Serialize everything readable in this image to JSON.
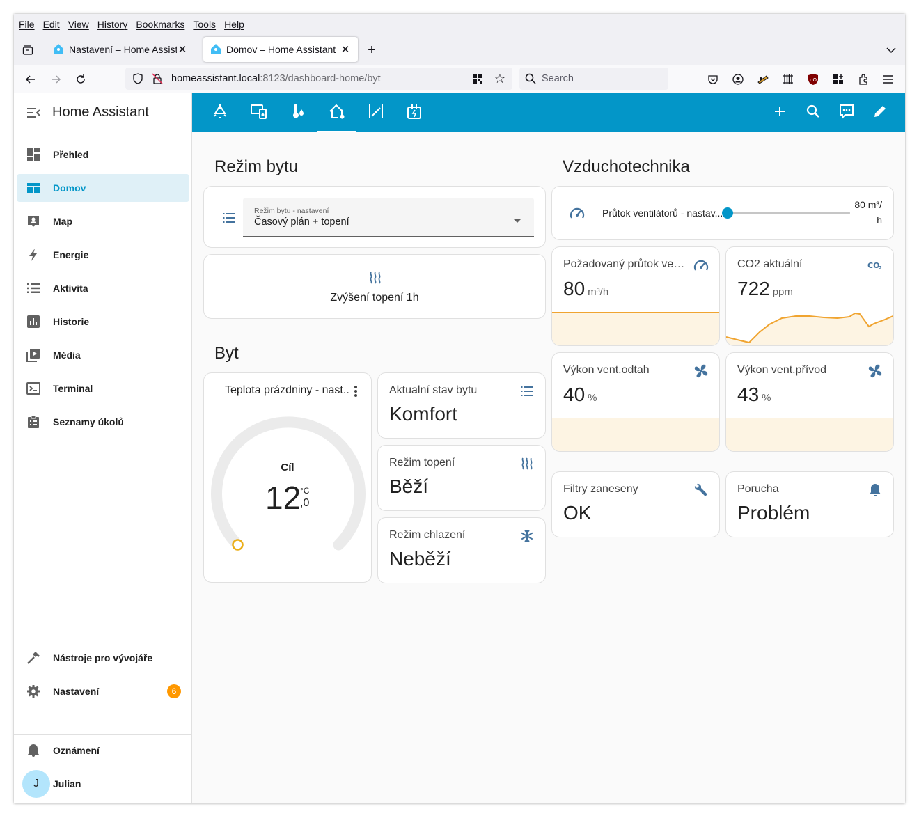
{
  "browser": {
    "menu": [
      "File",
      "Edit",
      "View",
      "History",
      "Bookmarks",
      "Tools",
      "Help"
    ],
    "tabs": [
      {
        "title": "Nastavení – Home Assistant"
      },
      {
        "title": "Domov – Home Assistant"
      }
    ],
    "url_host": "homeassistant.local",
    "url_path": ":8123/dashboard-home/byt",
    "search_placeholder": "Search"
  },
  "sidebar": {
    "title": "Home Assistant",
    "items": [
      {
        "label": "Přehled",
        "icon": "dashboard-icon"
      },
      {
        "label": "Domov",
        "icon": "view-dashboard-icon",
        "selected": true
      },
      {
        "label": "Map",
        "icon": "map-account-icon"
      },
      {
        "label": "Energie",
        "icon": "lightning-icon"
      },
      {
        "label": "Aktivita",
        "icon": "list-icon"
      },
      {
        "label": "Historie",
        "icon": "chart-bar-icon"
      },
      {
        "label": "Média",
        "icon": "media-icon"
      },
      {
        "label": "Terminal",
        "icon": "console-icon"
      },
      {
        "label": "Seznamy úkolů",
        "icon": "clipboard-list-icon"
      }
    ],
    "bottom": {
      "dev_tools": "Nástroje pro vývojáře",
      "settings": "Nastavení",
      "settings_badge": "6",
      "notifications": "Oznámení",
      "user": "Julian",
      "user_initial": "J"
    }
  },
  "colors": {
    "primary": "#0396c8",
    "accent_orange": "#ff9800",
    "icon_blue": "#44739e",
    "graph_line": "#f0a430"
  },
  "left_column": {
    "mode_title": "Režim bytu",
    "select": {
      "label": "Režim bytu - nastavení",
      "value": "Časový plán + topení"
    },
    "boost_button": "Zvýšení topení 1h",
    "byt_title": "Byt",
    "thermostat": {
      "name": "Teplota prázdniny - nast...",
      "target_label": "Cíl",
      "value_int": "12",
      "value_dec": ",0",
      "unit": "°C"
    },
    "tiles": [
      {
        "name": "Aktualní stav bytu",
        "state": "Komfort",
        "icon": "list-icon"
      },
      {
        "name": "Režim topení",
        "state": "Běží",
        "icon": "heat-wave-icon"
      },
      {
        "name": "Režim chlazení",
        "state": "Neběží",
        "icon": "snowflake-icon"
      }
    ]
  },
  "right_column": {
    "title": "Vzduchotechnika",
    "slider": {
      "name": "Průtok ventilátorů - nastav...",
      "value_line1": "80 m³/",
      "value_line2": "h",
      "position_fraction": 0.0
    },
    "sensors": [
      {
        "name": "Požadovaný průtok vent...",
        "value": "80",
        "unit": "m³/h",
        "icon": "speedometer-icon"
      },
      {
        "name": "CO2 aktuální",
        "value": "722",
        "unit": "ppm",
        "icon": "co2-icon"
      },
      {
        "name": "Výkon vent.odtah",
        "value": "40",
        "unit": "%",
        "icon": "fan-icon"
      },
      {
        "name": "Výkon vent.přívod",
        "value": "43",
        "unit": "%",
        "icon": "fan-icon"
      }
    ],
    "status_tiles": [
      {
        "name": "Filtry zaneseny",
        "state": "OK",
        "icon": "wrench-icon"
      },
      {
        "name": "Porucha",
        "state": "Problém",
        "icon": "bell-icon"
      }
    ]
  }
}
